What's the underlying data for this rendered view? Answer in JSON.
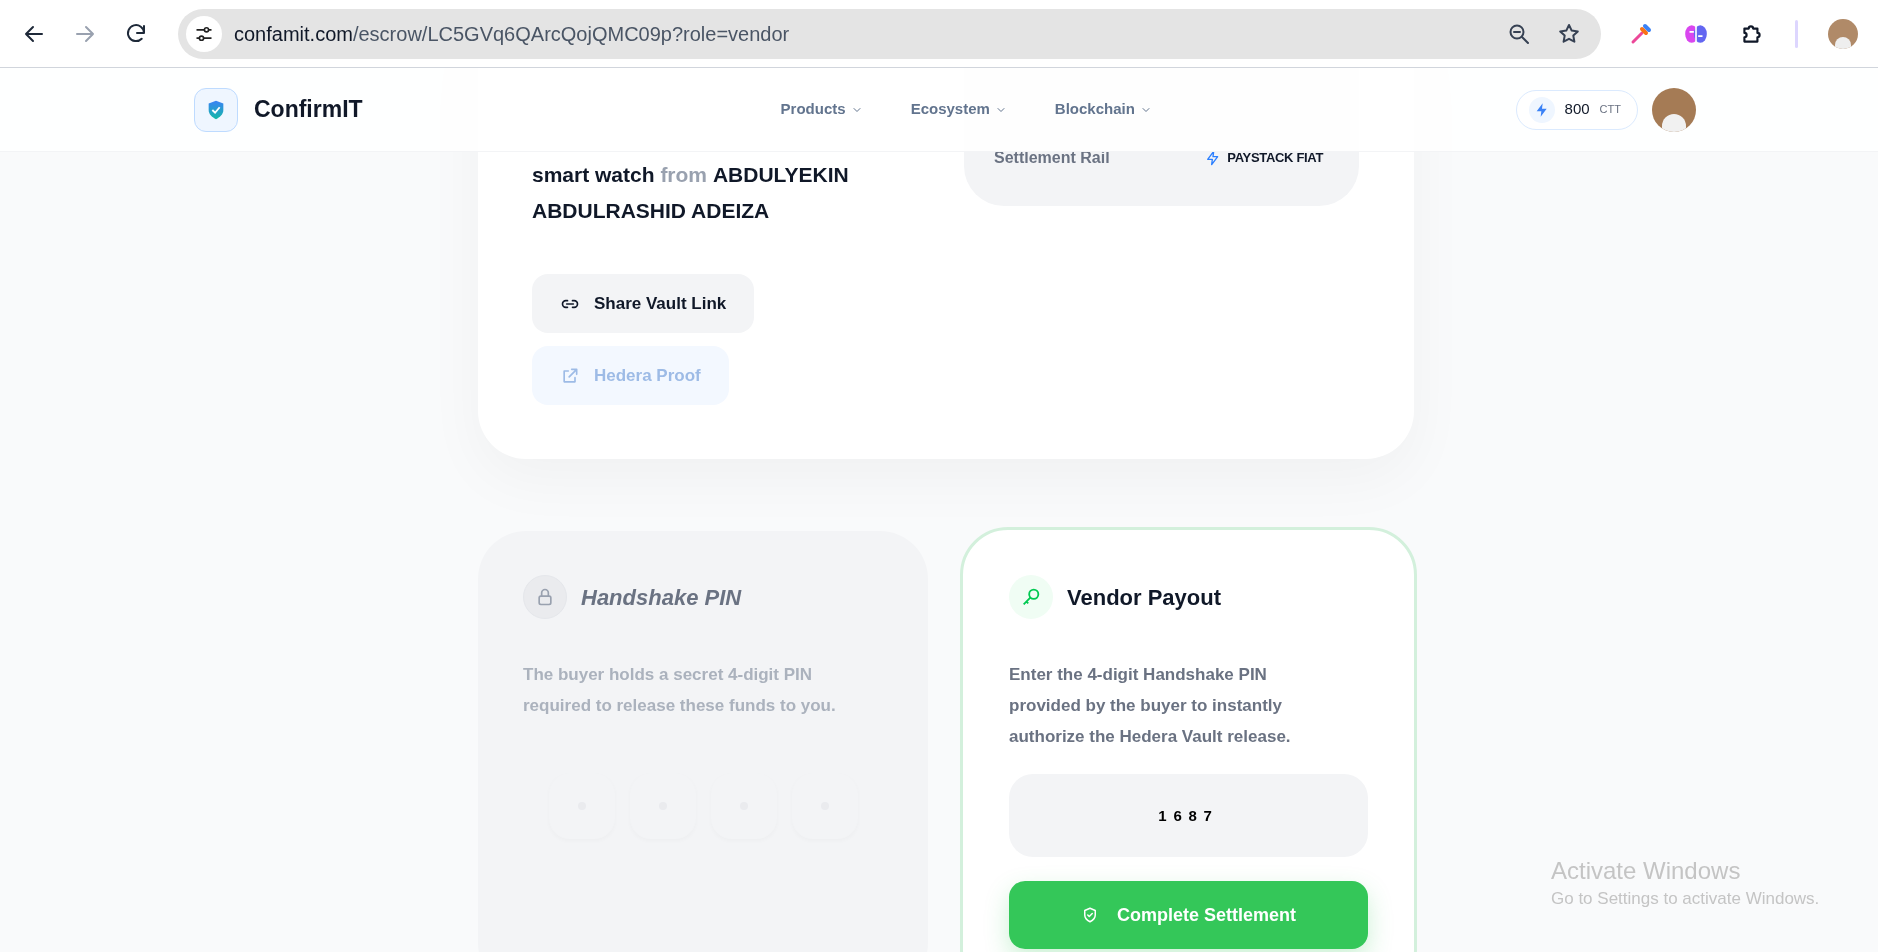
{
  "browser": {
    "url_host": "confamit.com",
    "url_path": "/escrow/LC5GVq6QArcQojQMC09p?role=vendor"
  },
  "header": {
    "brand": "ConfirmIT",
    "nav": [
      {
        "label": "Products"
      },
      {
        "label": "Ecosystem"
      },
      {
        "label": "Blockchain"
      }
    ],
    "credits": {
      "value": "800",
      "unit": "CTT"
    }
  },
  "vault": {
    "summary": "**smart watch** from **ABDULYEKIN ABDULRASHID ADEIZA**",
    "details": [
      {
        "label": "Settlement Rail",
        "value": "PAYSTACK FIAT"
      }
    ],
    "actions": [
      {
        "kind": "link",
        "label": "Share Vault Link",
        "disabled": false
      },
      {
        "kind": "external",
        "label": "Hedera Proof",
        "disabled": true
      }
    ]
  },
  "handshake": {
    "title": "Handshake PIN",
    "description": "The buyer holds a secret 4-digit PIN required to release these funds to you.",
    "disabled": true,
    "pin_slots": [
      {
        "filled": false
      },
      {
        "filled": false
      },
      {
        "filled": false
      },
      {
        "filled": false
      }
    ]
  },
  "payout": {
    "title": "Vendor Payout",
    "description": "Enter the 4-digit Handshake PIN provided by the buyer to instantly authorize the Hedera Vault release.",
    "pin_value": "1687",
    "button": "Complete Settlement"
  },
  "os_overlay": {
    "title": "Activate Windows",
    "subtitle": "Go to Settings to activate Windows."
  }
}
